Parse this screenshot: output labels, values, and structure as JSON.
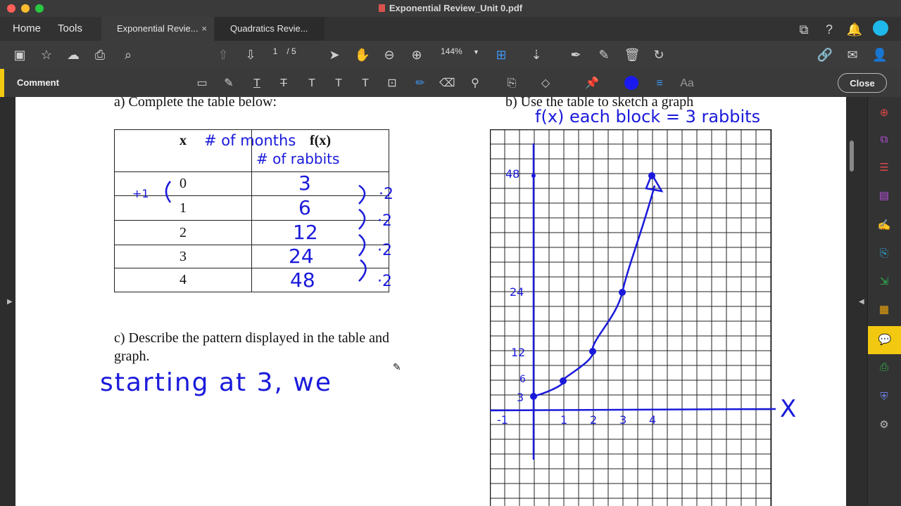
{
  "window": {
    "title": "Exponential Review_Unit 0.pdf"
  },
  "nav": {
    "home": "Home",
    "tools": "Tools"
  },
  "tabs": [
    {
      "label": "Exponential Revie...",
      "close": "×"
    },
    {
      "label": "Quadratics Revie..."
    }
  ],
  "toolbar": {
    "page_current": "1",
    "page_total": "/ 5",
    "zoom": "144%"
  },
  "commentbar": {
    "label": "Comment",
    "font_label": "Aa",
    "close_label": "Close"
  },
  "colors": {
    "accent": "#f2c811",
    "ink": "#1a1adb"
  },
  "document": {
    "part_a": "a) Complete the table below:",
    "part_b": "b) Use the table to sketch a graph",
    "part_c_line1": "c) Describe the pattern displayed in the table and",
    "part_c_line2": "graph.",
    "table": {
      "header_x": "x",
      "header_fx": "f(x)",
      "header_x_note": "# of months",
      "header_fx_note": "# of rabbits",
      "x_values": [
        "0",
        "1",
        "2",
        "3",
        "4"
      ],
      "fx_values": [
        "3",
        "6",
        "12",
        "24",
        "48"
      ],
      "ratio_labels": [
        "·2",
        "·2",
        "·2",
        "·2"
      ],
      "step_label": "+1"
    },
    "graph": {
      "scale_note": "f(x) each block = 3 rabbits",
      "x_axis_label": "X",
      "x_ticks": [
        "-1",
        "1",
        "2",
        "3",
        "4"
      ],
      "y_ticks": [
        "3",
        "6",
        "12",
        "24",
        "48"
      ]
    },
    "answer_c": "starting at 3, we"
  }
}
